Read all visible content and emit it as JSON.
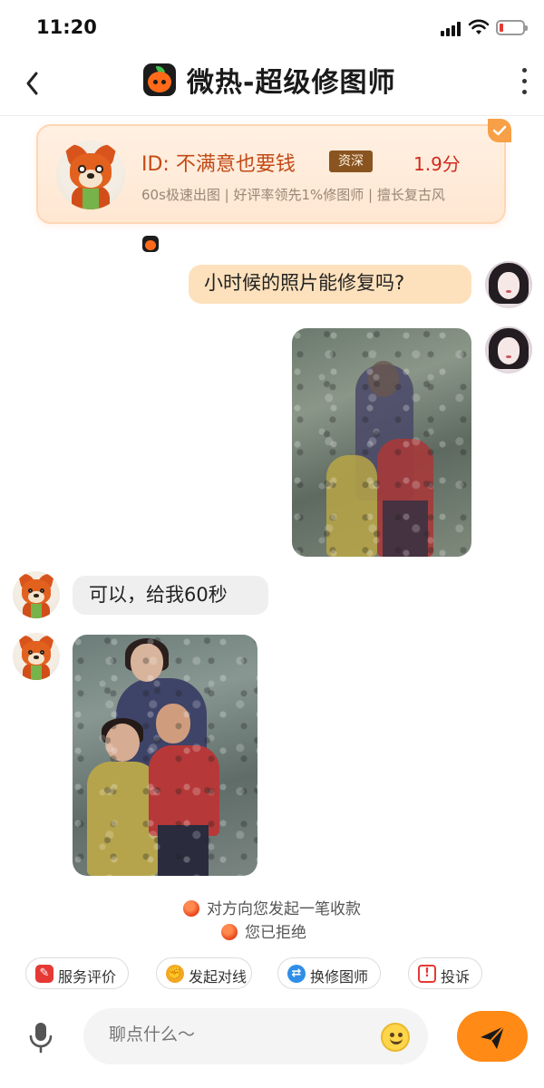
{
  "status_bar": {
    "time": "11:20"
  },
  "header": {
    "title": "微热-超级修图师"
  },
  "profile_card": {
    "id_text": "ID: 不满意也要钱",
    "level_badge": "资深",
    "score": "1.9分",
    "tags": "60s极速出图 | 好评率领先1%修图师 | 擅长复古风"
  },
  "messages": [
    {
      "from": "user",
      "type": "text",
      "text": "小时候的照片能修复吗?"
    },
    {
      "from": "user",
      "type": "image",
      "icon": "old-damaged-family-photo"
    },
    {
      "from": "designer",
      "type": "text",
      "text": "可以，给我60秒"
    },
    {
      "from": "designer",
      "type": "image",
      "icon": "restored-family-photo"
    }
  ],
  "notices": [
    {
      "text": "对方向您发起一笔收款",
      "icon": "orange-dot-icon"
    },
    {
      "text": "您已拒绝",
      "icon": "orange-dot-icon"
    }
  ],
  "quick_actions": [
    {
      "label": "服务评价",
      "icon": "review-icon",
      "color": "#e53935"
    },
    {
      "label": "发起对线",
      "icon": "duel-icon",
      "color": "#f5a623"
    },
    {
      "label": "换修图师",
      "icon": "switch-icon",
      "color": "#2f8ee8"
    },
    {
      "label": "投诉",
      "icon": "complaint-icon",
      "color": "#e53935"
    }
  ],
  "input_bar": {
    "placeholder": "聊点什么～"
  },
  "colors": {
    "accent": "#ff8a16",
    "outgoing_bubble": "#fde1bc",
    "incoming_bubble": "#efefef",
    "card_bg": "#ffe7d2",
    "score": "#d02a1e"
  }
}
